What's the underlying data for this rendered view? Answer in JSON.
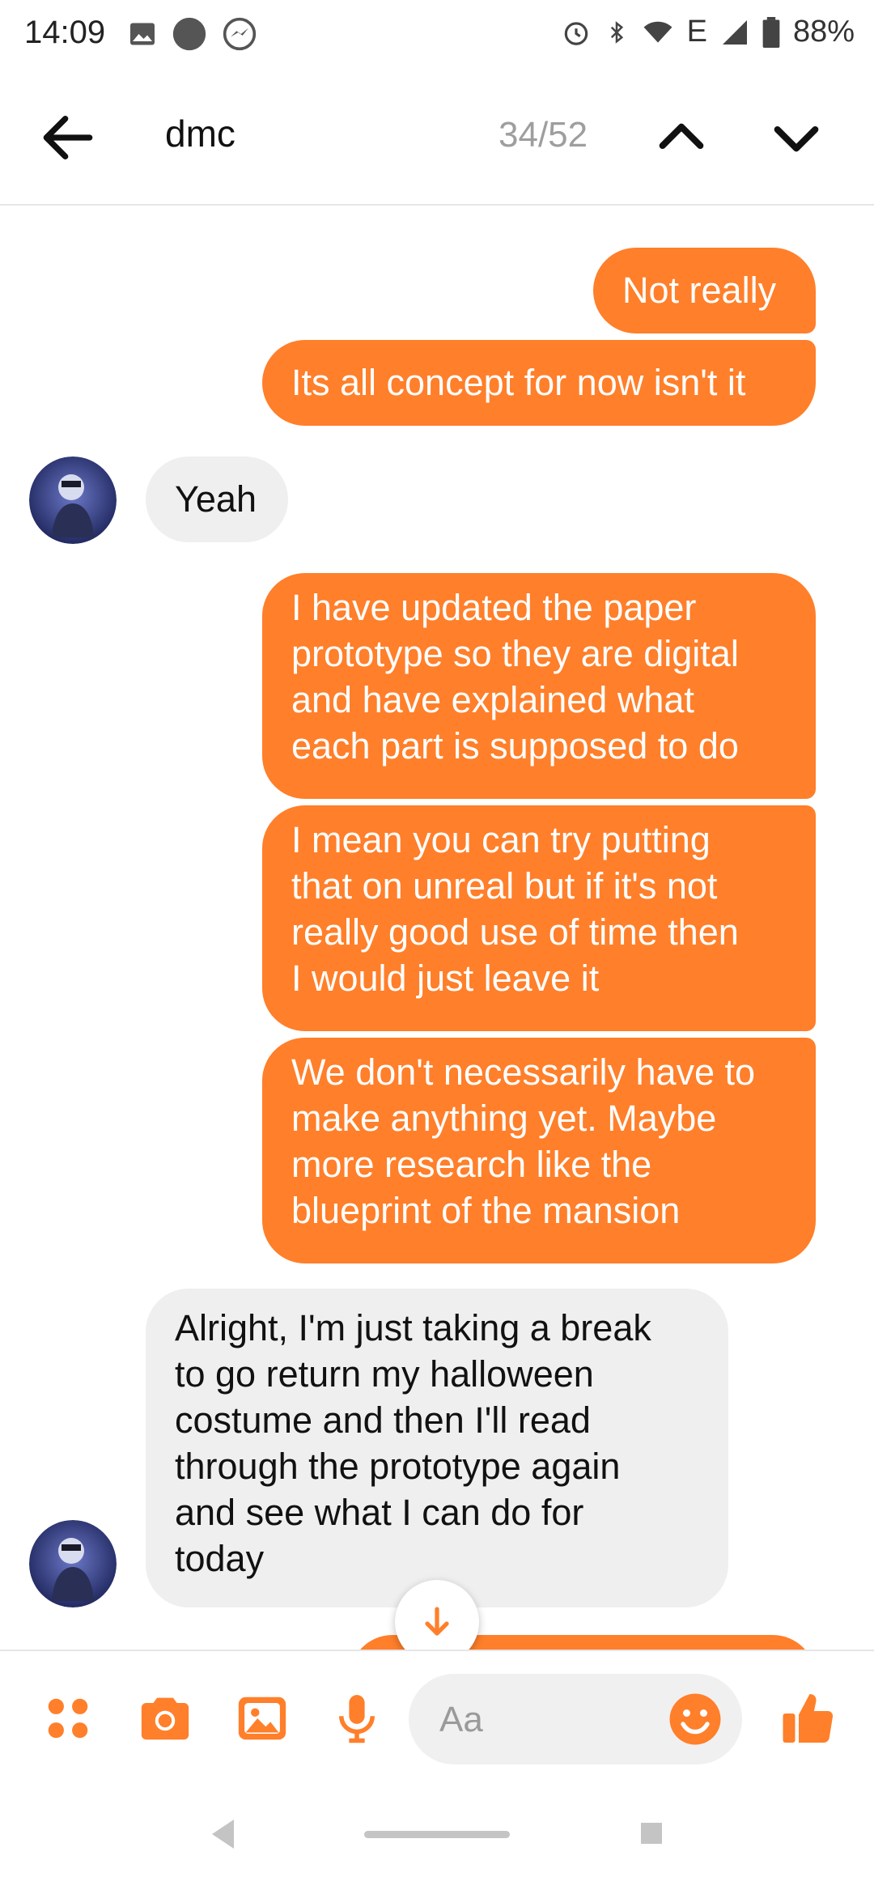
{
  "status_bar": {
    "time": "14:09",
    "network": "E",
    "battery": "88%"
  },
  "header": {
    "search_query": "dmc",
    "match_counter": "34/52"
  },
  "messages": [
    {
      "direction": "outgoing",
      "text": "Not really"
    },
    {
      "direction": "outgoing",
      "text": "Its all concept for now isn't it"
    },
    {
      "direction": "incoming",
      "text": "Yeah"
    },
    {
      "direction": "outgoing",
      "lines": [
        "I have updated the paper",
        "prototype so they are digital",
        "and have explained what",
        "each part is supposed to do"
      ]
    },
    {
      "direction": "outgoing",
      "lines": [
        "I mean you can try putting",
        "that on unreal but if it's not",
        "really good use of time then",
        "I would just leave it"
      ]
    },
    {
      "direction": "outgoing",
      "lines": [
        "We don't necessarily have to",
        "make anything yet. Maybe",
        "more research like the",
        "blueprint of the mansion"
      ]
    },
    {
      "direction": "incoming",
      "lines": [
        "Alright, I'm just taking a break",
        "to go return my halloween",
        "costume and then I'll read",
        "through the prototype again",
        "and see what I can do for",
        "today"
      ]
    }
  ],
  "composer": {
    "placeholder": "Aa"
  },
  "colors": {
    "accent": "#ff7f2a",
    "incoming_bubble": "#efefef"
  },
  "icons": [
    "back-arrow-icon",
    "chevron-up-icon",
    "chevron-down-icon",
    "arrow-down-icon",
    "apps-dots-icon",
    "camera-icon",
    "image-icon",
    "microphone-icon",
    "smiley-icon",
    "thumbs-up-icon"
  ]
}
